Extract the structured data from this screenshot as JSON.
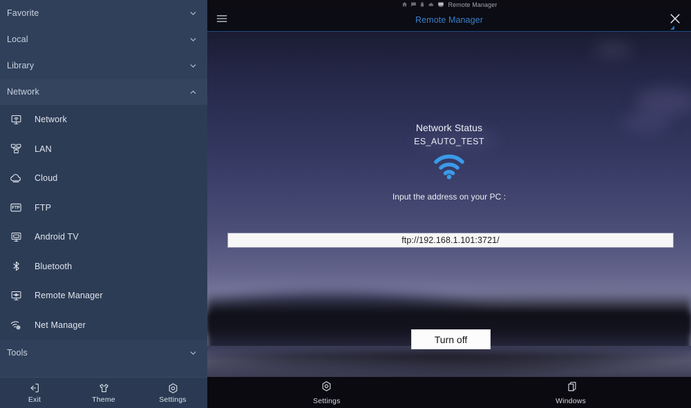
{
  "sidebar": {
    "groups": [
      {
        "label": "Favorite",
        "expanded": false,
        "icon": "chevron-down-icon"
      },
      {
        "label": "Local",
        "expanded": false,
        "icon": "chevron-down-icon"
      },
      {
        "label": "Library",
        "expanded": false,
        "icon": "chevron-down-icon"
      },
      {
        "label": "Network",
        "expanded": true,
        "icon": "chevron-up-icon"
      },
      {
        "label": "Tools",
        "expanded": false,
        "icon": "chevron-down-icon"
      }
    ],
    "network_items": [
      {
        "label": "Network",
        "icon": "monitor-wifi-icon"
      },
      {
        "label": "LAN",
        "icon": "lan-nodes-icon"
      },
      {
        "label": "Cloud",
        "icon": "cloud-icon"
      },
      {
        "label": "FTP",
        "icon": "ftp-icon"
      },
      {
        "label": "Android TV",
        "icon": "android-tv-icon"
      },
      {
        "label": "Bluetooth",
        "icon": "bluetooth-icon"
      },
      {
        "label": "Remote Manager",
        "icon": "remote-manager-icon"
      },
      {
        "label": "Net Manager",
        "icon": "net-manager-icon"
      }
    ],
    "bottom_bar": [
      {
        "label": "Exit",
        "icon": "exit-icon"
      },
      {
        "label": "Theme",
        "icon": "tshirt-icon"
      },
      {
        "label": "Settings",
        "icon": "gear-icon"
      }
    ]
  },
  "statusbar": {
    "app_title": "Remote Manager",
    "icons": [
      "home-icon",
      "chat-icon",
      "lock-icon",
      "cloud-icon",
      "remote-manager-icon"
    ]
  },
  "titlebar": {
    "title": "Remote Manager",
    "menu_icon": "hamburger-menu-icon",
    "close_icon": "close-icon",
    "accent_color": "#3d7fc9",
    "border_color": "#1d4a82"
  },
  "main": {
    "status_heading": "Network Status",
    "ssid": "ES_AUTO_TEST",
    "wifi_icon": "wifi-signal-icon",
    "wifi_color": "#3b9ae8",
    "hint": "Input the address on your PC :",
    "address": "ftp://192.168.1.101:3721/",
    "turn_off_label": "Turn off"
  },
  "bottom_nav": [
    {
      "label": "Settings",
      "icon": "gear-icon"
    },
    {
      "label": "Windows",
      "icon": "windows-stack-icon"
    }
  ]
}
